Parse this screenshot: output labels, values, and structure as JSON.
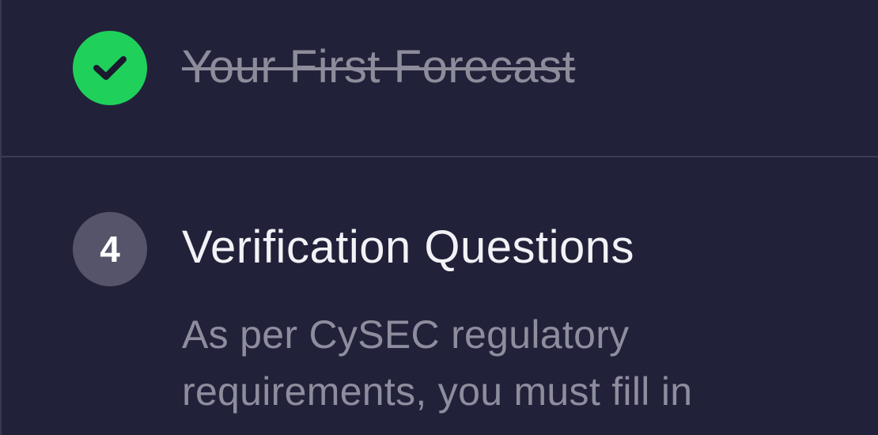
{
  "steps": {
    "completed": {
      "title": "Your First Forecast",
      "status": "completed",
      "icon": "checkmark-icon",
      "badge_color": "#1fd15a"
    },
    "active": {
      "number": "4",
      "title": "Verification Questions",
      "description": "As per CySEC regulatory requirements, you must fill in",
      "badge_color": "#55546b"
    }
  }
}
